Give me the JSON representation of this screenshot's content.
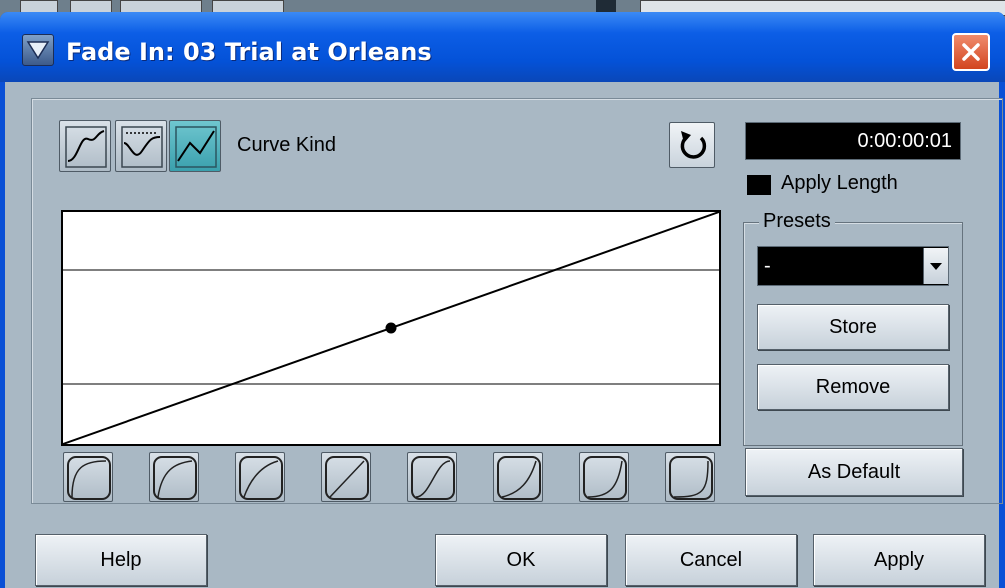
{
  "window": {
    "title": "Fade In: 03 Trial at Orleans"
  },
  "curve_kind": {
    "label": "Curve Kind",
    "buttons": [
      {
        "name": "spline-curve",
        "active": false
      },
      {
        "name": "damped-spline-curve",
        "active": false
      },
      {
        "name": "linear-curve",
        "active": true
      }
    ]
  },
  "length": {
    "value": "0:00:00:01",
    "apply_length_label": "Apply Length",
    "apply_length_checked": true
  },
  "presets": {
    "legend": "Presets",
    "selected": "-",
    "store_label": "Store",
    "remove_label": "Remove"
  },
  "as_default_label": "As Default",
  "footer": {
    "help_label": "Help",
    "ok_label": "OK",
    "cancel_label": "Cancel",
    "apply_label": "Apply"
  },
  "colors": {
    "title_bar": "#0452d8",
    "dialog_bg": "#a9b8c4",
    "active_button": "#3aa0ad"
  }
}
